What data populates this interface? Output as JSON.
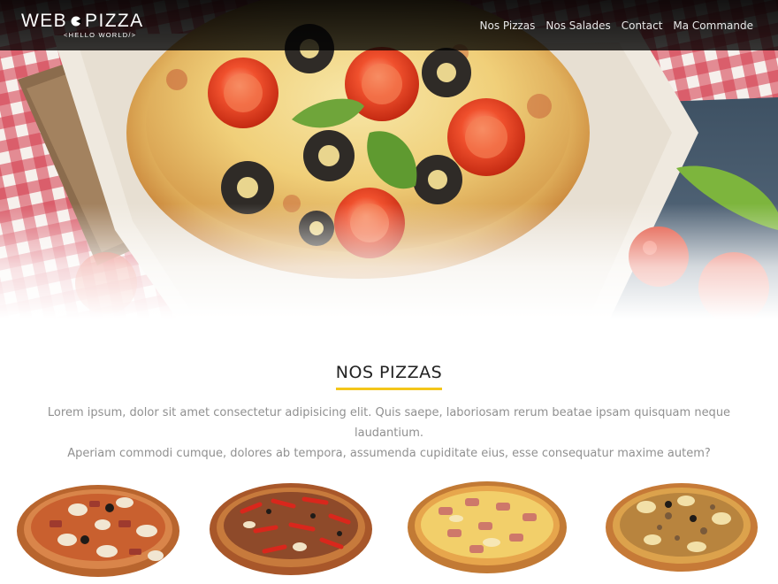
{
  "brand": {
    "name_left": "WEB",
    "name_right": "PIZZA",
    "tagline": "<HELLO WORLD/>",
    "accent_color": "#f4c61a"
  },
  "nav": {
    "items": [
      {
        "label": "Nos Pizzas"
      },
      {
        "label": "Nos Salades"
      },
      {
        "label": "Contact"
      },
      {
        "label": "Ma Commande"
      }
    ]
  },
  "hero": {
    "image": "pizza-hero-photo"
  },
  "section": {
    "title": "NOS PIZZAS",
    "description_line1": "Lorem ipsum, dolor sit amet consectetur adipisicing elit. Quis saepe, laboriosam rerum beatae ipsam quisquam neque laudantium.",
    "description_line2": "Aperiam commodi cumque, dolores ab tempora, assumenda cupiditate eius, esse consequatur maxime autem?"
  },
  "pizzas": [
    {
      "image": "pizza-photo-1"
    },
    {
      "image": "pizza-photo-2"
    },
    {
      "image": "pizza-photo-3"
    },
    {
      "image": "pizza-photo-4"
    }
  ]
}
